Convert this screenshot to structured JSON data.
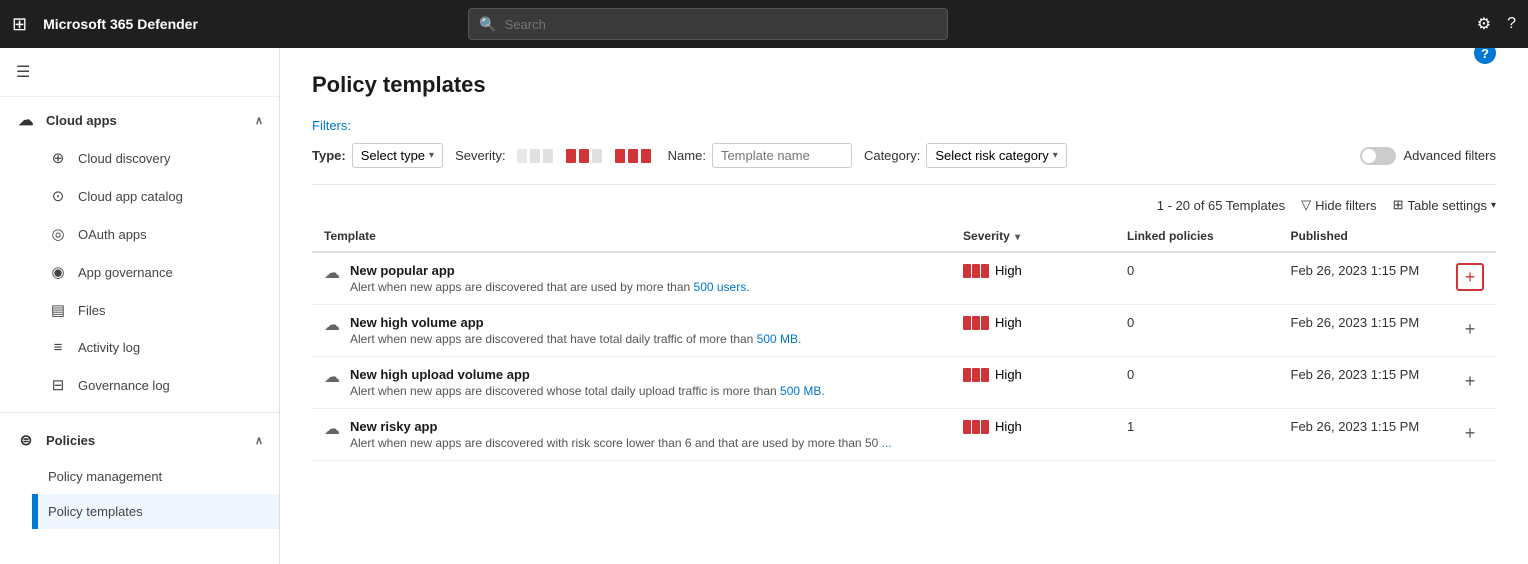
{
  "topnav": {
    "title": "Microsoft 365 Defender",
    "search_placeholder": "Search"
  },
  "sidebar": {
    "hamburger_label": "☰",
    "cloud_apps_label": "Cloud apps",
    "cloud_discovery_label": "Cloud discovery",
    "cloud_app_catalog_label": "Cloud app catalog",
    "oauth_apps_label": "OAuth apps",
    "app_governance_label": "App governance",
    "files_label": "Files",
    "activity_log_label": "Activity log",
    "governance_log_label": "Governance log",
    "policies_label": "Policies",
    "policy_management_label": "Policy management",
    "policy_templates_label": "Policy templates"
  },
  "page": {
    "title": "Policy templates",
    "filters_label": "Filters:",
    "type_label": "Type:",
    "type_value": "Select type",
    "severity_label": "Severity:",
    "name_label": "Name:",
    "name_placeholder": "Template name",
    "category_label": "Category:",
    "category_value": "Select risk category",
    "advanced_filters_label": "Advanced filters",
    "table_count": "1 - 20 of 65 Templates",
    "hide_filters_label": "Hide filters",
    "table_settings_label": "Table settings",
    "col_template": "Template",
    "col_severity": "Severity",
    "col_linked": "Linked policies",
    "col_published": "Published",
    "rows": [
      {
        "name": "New popular app",
        "desc_prefix": "Alert when new apps are discovered that are used by more than ",
        "desc_link": "500 users.",
        "desc_suffix": "",
        "severity": "High",
        "linked": "0",
        "published": "Feb 26, 2023 1:15 PM",
        "add_highlighted": true
      },
      {
        "name": "New high volume app",
        "desc_prefix": "Alert when new apps are discovered that have total daily traffic of more than ",
        "desc_link": "500 MB.",
        "desc_suffix": "",
        "severity": "High",
        "linked": "0",
        "published": "Feb 26, 2023 1:15 PM",
        "add_highlighted": false
      },
      {
        "name": "New high upload volume app",
        "desc_prefix": "Alert when new apps are discovered whose total daily upload traffic is more than ",
        "desc_link": "500 MB.",
        "desc_suffix": "",
        "severity": "High",
        "linked": "0",
        "published": "Feb 26, 2023 1:15 PM",
        "add_highlighted": false
      },
      {
        "name": "New risky app",
        "desc_prefix": "Alert when new apps are discovered with risk score lower than 6 and that are used by more than 50 ",
        "desc_link": "...",
        "desc_suffix": "",
        "severity": "High",
        "linked": "1",
        "published": "Feb 26, 2023 1:15 PM",
        "add_highlighted": false
      }
    ]
  }
}
